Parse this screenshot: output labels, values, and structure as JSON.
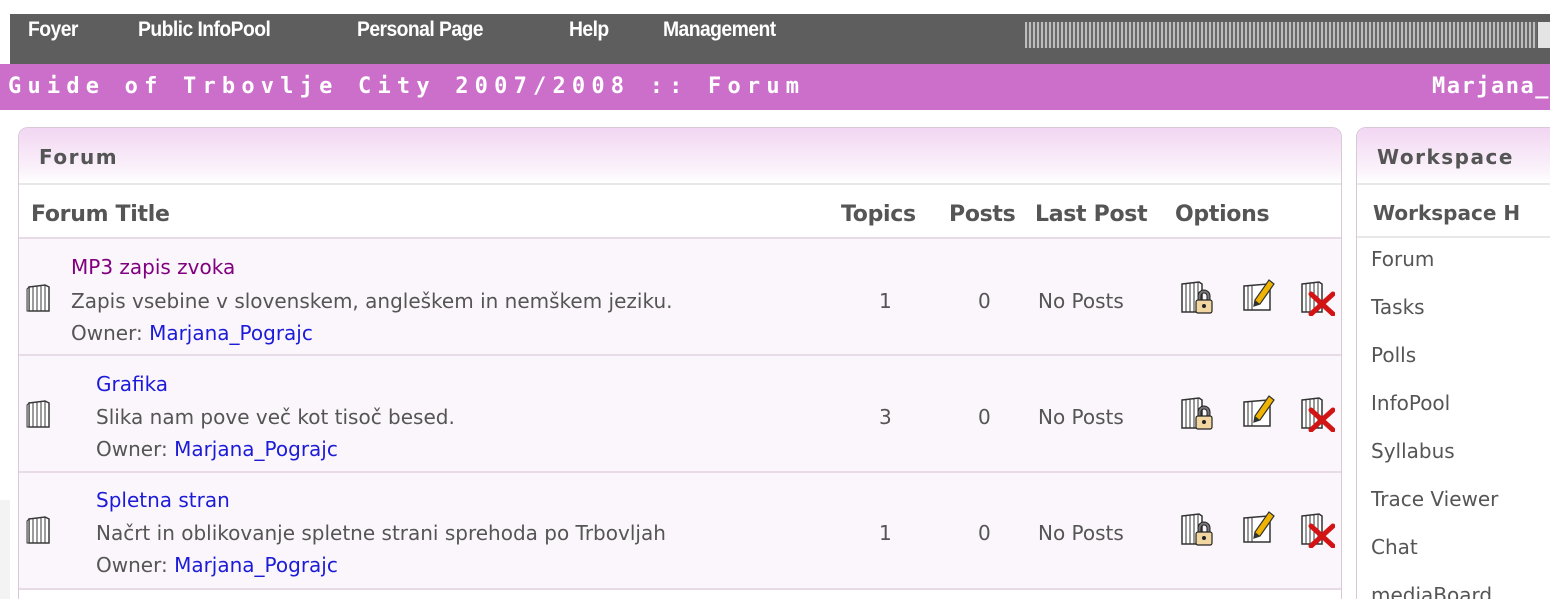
{
  "nav": {
    "items": [
      "Foyer",
      "Public InfoPool",
      "Personal Page",
      "Help",
      "Management"
    ]
  },
  "titlebar": {
    "text": "Guide of Trbovlje City 2007/2008 :: Forum",
    "user": "Marjana_"
  },
  "forum_panel": {
    "heading": "Forum",
    "columns": {
      "title": "Forum Title",
      "topics": "Topics",
      "posts": "Posts",
      "last_post": "Last Post",
      "options": "Options"
    },
    "owner_label": "Owner:",
    "forums": [
      {
        "title": "MP3 zapis zvoka",
        "description": "Zapis vsebine v slovenskem, angleškem in nemškem jeziku.",
        "owner": "Marjana_Pograjc",
        "topics": "1",
        "posts": "0",
        "last_post": "No Posts",
        "visited": true
      },
      {
        "title": "Grafika",
        "description": "Slika nam pove več kot tisoč besed.",
        "owner": "Marjana_Pograjc",
        "topics": "3",
        "posts": "0",
        "last_post": "No Posts",
        "visited": false
      },
      {
        "title": "Spletna stran",
        "description": "Načrt in oblikovanje spletne strani sprehoda po Trbovljah",
        "owner": "Marjana_Pograjc",
        "topics": "1",
        "posts": "0",
        "last_post": "No Posts",
        "visited": false
      }
    ]
  },
  "workspace_panel": {
    "heading": "Workspace",
    "subheading": "Workspace H",
    "items": [
      "Forum",
      "Tasks",
      "Polls",
      "InfoPool",
      "Syllabus",
      "Trace Viewer",
      "Chat",
      "mediaBoard"
    ]
  },
  "icons": {
    "forum": "forum-folder-icon",
    "lock": "lock-forum-icon",
    "edit": "edit-forum-icon",
    "delete": "delete-forum-icon"
  },
  "colors": {
    "nav_bg": "#5e5e5e",
    "title_bg": "#cb6fcb",
    "visited_link": "#800080",
    "link": "#1c1cd8",
    "text": "#555555",
    "delete_x": "#d21414",
    "pencil": "#f0b400"
  }
}
